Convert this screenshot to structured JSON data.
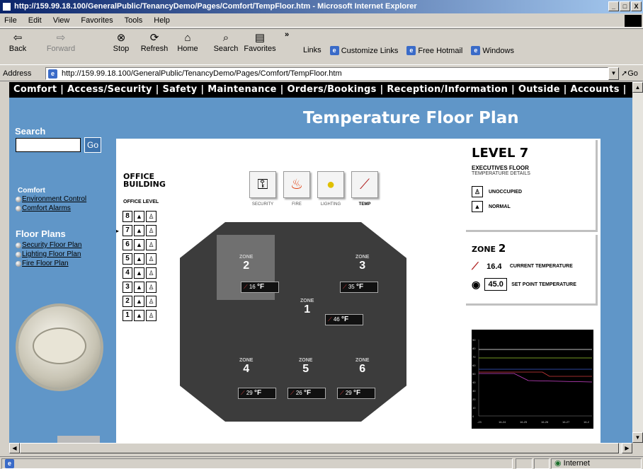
{
  "window": {
    "title": "http://159.99.18.100/GeneralPublic/TenancyDemo/Pages/Comfort/TempFloor.htm - Microsoft Internet Explorer",
    "min": "_",
    "max": "□",
    "close": "X"
  },
  "menu": [
    "File",
    "Edit",
    "View",
    "Favorites",
    "Tools",
    "Help"
  ],
  "toolbar": {
    "back": "Back",
    "forward": "Forward",
    "stop": "Stop",
    "refresh": "Refresh",
    "home": "Home",
    "search": "Search",
    "favorites": "Favorites",
    "more": "»",
    "links_label": "Links",
    "links": [
      "Customize Links",
      "Free Hotmail",
      "Windows"
    ]
  },
  "address": {
    "label": "Address",
    "url": "http://159.99.18.100/GeneralPublic/TenancyDemo/Pages/Comfort/TempFloor.htm",
    "go": "Go"
  },
  "nav_bar": "Comfort  | Access/Security  | Safety  | Maintenance  | Orders/Bookings  | Reception/Information  | Outside  | Accounts  |",
  "page_title": "Temperature Floor Plan",
  "sidebar": {
    "search_label": "Search",
    "go": "Go",
    "comfort_heading": "Comfort",
    "comfort_links": [
      "Environment Control",
      "Comfort Alarms"
    ],
    "floorplans_heading": "Floor Plans",
    "floorplan_links": [
      "Security Floor Plan",
      "Lighting Floor Plan",
      "Fire Floor Plan"
    ]
  },
  "building": {
    "title_line1": "OFFICE",
    "title_line2": "BUILDING",
    "level_label": "OFFICE LEVEL",
    "floors": [
      "8",
      "7",
      "6",
      "5",
      "4",
      "3",
      "2",
      "1"
    ],
    "selected_floor": "7"
  },
  "categories": [
    {
      "label": "SECURITY",
      "icon": "key-icon"
    },
    {
      "label": "FIRE",
      "icon": "fire-icon"
    },
    {
      "label": "LIGHTING",
      "icon": "bulb-icon"
    },
    {
      "label": "TEMP",
      "icon": "thermometer-icon"
    }
  ],
  "zones": [
    {
      "label": "ZONE",
      "num": "2",
      "temp": "16",
      "unit": "°F"
    },
    {
      "label": "ZONE",
      "num": "3",
      "temp": "35",
      "unit": "°F"
    },
    {
      "label": "ZONE",
      "num": "1",
      "temp": "46",
      "unit": "°F"
    },
    {
      "label": "ZONE",
      "num": "4",
      "temp": "29",
      "unit": "°F"
    },
    {
      "label": "ZONE",
      "num": "5",
      "temp": "26",
      "unit": "°F"
    },
    {
      "label": "ZONE",
      "num": "6",
      "temp": "29",
      "unit": "°F"
    }
  ],
  "level_panel": {
    "title": "LEVEL 7",
    "subtitle": "EXECUTIVES FLOOR",
    "details": "TEMPERATURE DETAILS",
    "legend": [
      "UNOCCUPIED",
      "NORMAL"
    ]
  },
  "zone_panel": {
    "label": "ZONE",
    "num": "2",
    "current_value": "16.4",
    "current_label": "CURRENT TEMPERATURE",
    "setpoint_value": "45.0",
    "setpoint_label": "SET POINT TEMPERATURE"
  },
  "trend_chart": {
    "y_ticks": [
      "90",
      "80",
      "70",
      "60",
      "50",
      "40",
      "30",
      "20",
      "10",
      "0"
    ],
    "x_ticks": [
      "-23",
      "16-24",
      "16-25",
      "16-26",
      "16-27",
      "16-2"
    ],
    "colors": {
      "bg": "#000000",
      "line1": "#3c5ad2",
      "line2": "#cc44cc",
      "line3": "#9acd32",
      "line4": "#ffffff",
      "line5": "#d23c3c"
    }
  },
  "status": {
    "zone": "Internet"
  },
  "colors": {
    "page_bg": "#6096c8",
    "nav_bg": "#000000",
    "title_bar_start": "#0a246a",
    "title_bar_end": "#a6caf0"
  }
}
